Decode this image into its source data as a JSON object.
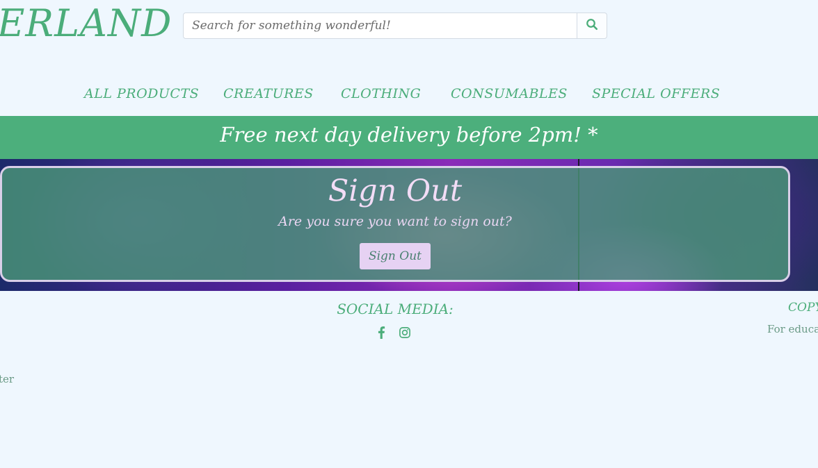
{
  "header": {
    "logo_text": "ERLAND",
    "search_placeholder": "Search for something wonderful!",
    "search_icon": "search-icon"
  },
  "nav": {
    "items": [
      {
        "label": "ALL PRODUCTS"
      },
      {
        "label": "CREATURES"
      },
      {
        "label": "CLOTHING"
      },
      {
        "label": "CONSUMABLES"
      },
      {
        "label": "SPECIAL OFFERS"
      }
    ]
  },
  "banner": {
    "text": "Free next day delivery before 2pm! *"
  },
  "signout": {
    "title": "Sign Out",
    "message": "Are you sure you want to sign out?",
    "button_label": "Sign Out"
  },
  "footer": {
    "social_title": "SOCIAL MEDIA:",
    "social_icons": [
      "facebook-icon",
      "instagram-icon"
    ],
    "copyright_title": "COPY",
    "copyright_text": "For educa",
    "left_text": "ter"
  },
  "colors": {
    "brand_green": "#4bad7a",
    "background": "#eff7fe",
    "button_lilac": "#e6d2f3"
  }
}
